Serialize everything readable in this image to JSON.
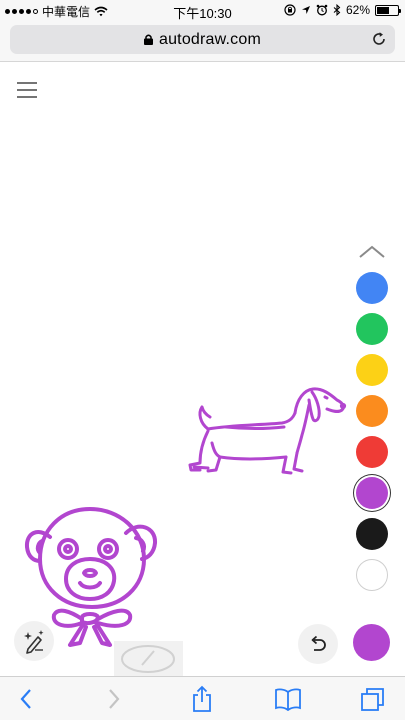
{
  "status": {
    "carrier": "中華電信",
    "time": "下午10:30",
    "battery": "62%",
    "battery_level": 0.62
  },
  "browser": {
    "url": "autodraw.com",
    "back_enabled": true,
    "forward_enabled": false
  },
  "app": {
    "palette": [
      {
        "name": "blue",
        "color": "#4285f4"
      },
      {
        "name": "green",
        "color": "#22c55e"
      },
      {
        "name": "yellow",
        "color": "#fcd116"
      },
      {
        "name": "orange",
        "color": "#fb8c1e"
      },
      {
        "name": "red",
        "color": "#ef3b36"
      },
      {
        "name": "purple",
        "color": "#b246cf",
        "selected": true
      },
      {
        "name": "black",
        "color": "#1a1a1a"
      },
      {
        "name": "white",
        "color": "#ffffff"
      }
    ],
    "current_color": "#b246cf",
    "stroke_color": "#b246cf",
    "drawings": [
      "dachshund",
      "teddy-bear-head"
    ],
    "icons": {
      "menu": "hamburger-menu-icon",
      "palette_toggle": "chevron-up-icon",
      "autodraw": "autodraw-sparkle-pencil-icon",
      "undo": "undo-icon",
      "back": "chevron-left-icon",
      "forward": "chevron-right-icon",
      "share": "share-icon",
      "bookmarks": "book-icon",
      "tabs": "tabs-icon"
    }
  }
}
